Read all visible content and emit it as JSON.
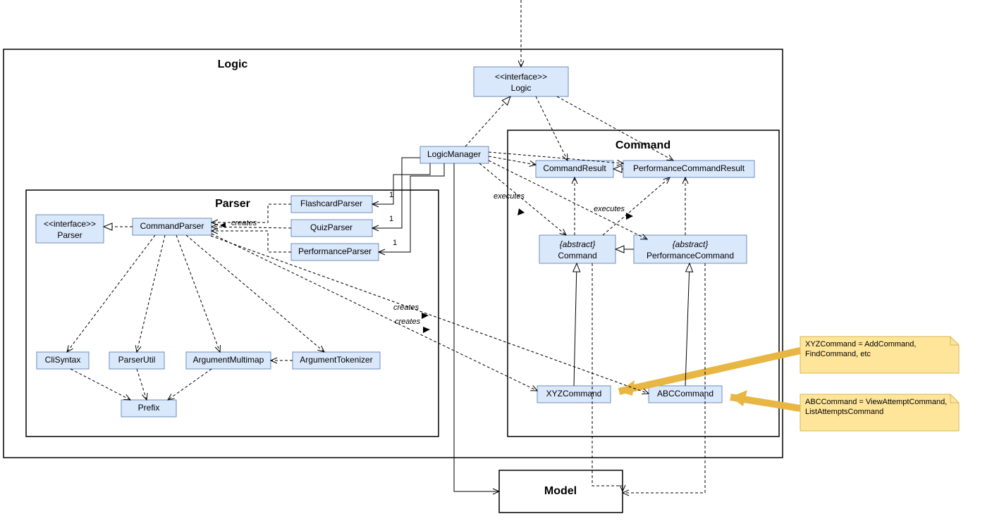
{
  "packages": {
    "logic": "Logic",
    "parser": "Parser",
    "command": "Command",
    "model": "Model"
  },
  "boxes": {
    "logicInterface": {
      "stereo": "<<interface>>",
      "name": "Logic"
    },
    "logicManager": "LogicManager",
    "parserInterface": {
      "stereo": "<<interface>>",
      "name": "Parser"
    },
    "commandParser": "CommandParser",
    "flashcardParser": "FlashcardParser",
    "quizParser": "QuizParser",
    "performanceParser": "PerformanceParser",
    "cliSyntax": "CliSyntax",
    "parserUtil": "ParserUtil",
    "argumentMultimap": "ArgumentMultimap",
    "argumentTokenizer": "ArgumentTokenizer",
    "prefix": "Prefix",
    "commandResult": "CommandResult",
    "performanceCommandResult": "PerformanceCommandResult",
    "absCommand": {
      "stereo": "{abstract}",
      "name": "Command"
    },
    "absPerfCommand": {
      "stereo": "{abstract}",
      "name": "PerformanceCommand"
    },
    "xyzCommand": "XYZCommand",
    "abcCommand": "ABCCommand"
  },
  "edgeLabels": {
    "creates": "creates",
    "executes": "executes",
    "one": "1"
  },
  "notes": {
    "xyz": "XYZCommand = AddCommand, FindCommand, etc",
    "abc": "ABCCommand = ViewAttemptCommand, ListAttemptsCommand"
  }
}
